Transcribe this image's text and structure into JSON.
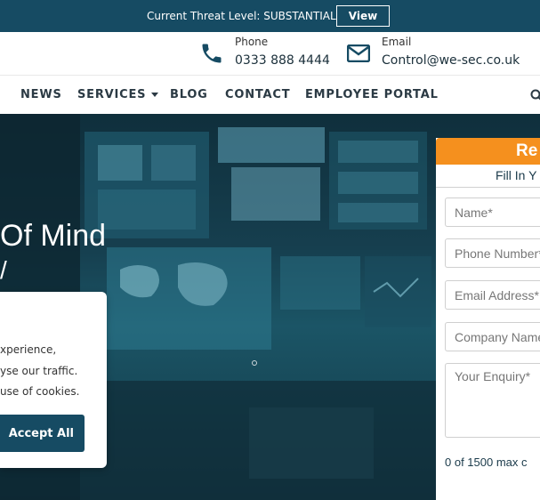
{
  "threat_bar": {
    "text": "Current Threat Level: SUBSTANTIAL",
    "view_label": "View"
  },
  "contact": {
    "phone_label": "Phone",
    "phone_value": "0333 888 4444",
    "email_label": "Email",
    "email_value": "Control@we-sec.co.uk"
  },
  "nav": {
    "items": [
      "NEWS",
      "SERVICES",
      "BLOG",
      "CONTACT",
      "EMPLOYEE PORTAL"
    ]
  },
  "hero": {
    "title_fragment": "Of Mind",
    "subtitle_fragment": "/"
  },
  "cookie": {
    "line1": "xperience,",
    "line2": "yse our traffic.",
    "line3": "use of cookies.",
    "accept_label": "Accept All"
  },
  "form": {
    "header": "Re",
    "subheader": "Fill In Y",
    "fields": [
      {
        "placeholder": "Name*"
      },
      {
        "placeholder": "Phone Number*"
      },
      {
        "placeholder": "Email Address*"
      },
      {
        "placeholder": "Company Name"
      }
    ],
    "enquiry_placeholder": "Your Enquiry*",
    "counter": "0 of  1500 max c"
  },
  "colors": {
    "brand_dark": "#164b63",
    "accent_orange": "#f5901e"
  },
  "icons": {
    "phone": "phone-icon",
    "email": "envelope-icon",
    "search": "search-icon"
  }
}
